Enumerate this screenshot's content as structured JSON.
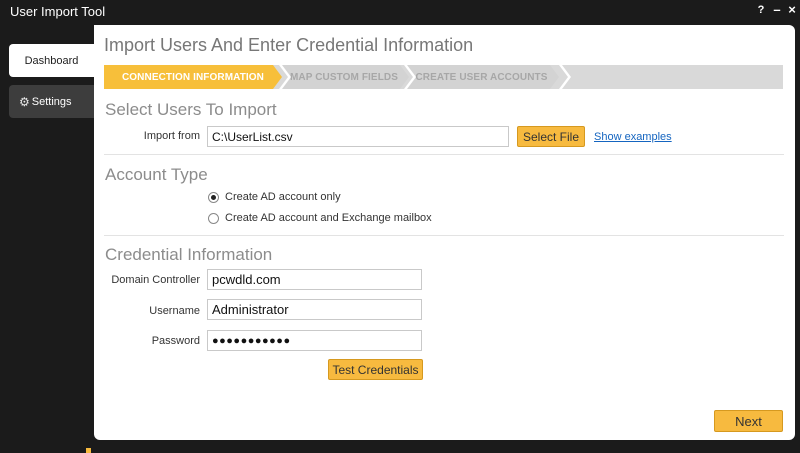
{
  "app": {
    "title": "User Import Tool",
    "window_controls": {
      "help": "?",
      "minimize": "–",
      "close": "×"
    }
  },
  "nav": {
    "dashboard_label": "Dashboard",
    "settings_label": "Settings",
    "settings_icon": "gear-icon"
  },
  "page": {
    "title": "Import Users And Enter Credential Information"
  },
  "steps": [
    {
      "label": "CONNECTION INFORMATION",
      "active": true
    },
    {
      "label": "MAP CUSTOM FIELDS",
      "active": false
    },
    {
      "label": "CREATE USER ACCOUNTS",
      "active": false
    }
  ],
  "import_section": {
    "title": "Select Users To Import",
    "import_from_label": "Import from",
    "import_from_value": "C:\\UserList.csv",
    "select_file_button": "Select File",
    "show_examples_link": "Show examples"
  },
  "account_section": {
    "title": "Account Type",
    "options": [
      {
        "label": "Create AD account only",
        "selected": true
      },
      {
        "label": "Create AD account and Exchange mailbox",
        "selected": false
      }
    ]
  },
  "credential_section": {
    "title": "Credential Information",
    "domain_controller_label": "Domain Controller",
    "domain_controller_value": "pcwdld.com",
    "username_label": "Username",
    "username_value": "Administrator",
    "password_label": "Password",
    "password_value": "●●●●●●●●●●●",
    "test_button": "Test Credentials"
  },
  "footer": {
    "next_button": "Next"
  },
  "colors": {
    "accent": "#f7ba3f",
    "background": "#1b1b1b",
    "link": "#1565c0"
  }
}
